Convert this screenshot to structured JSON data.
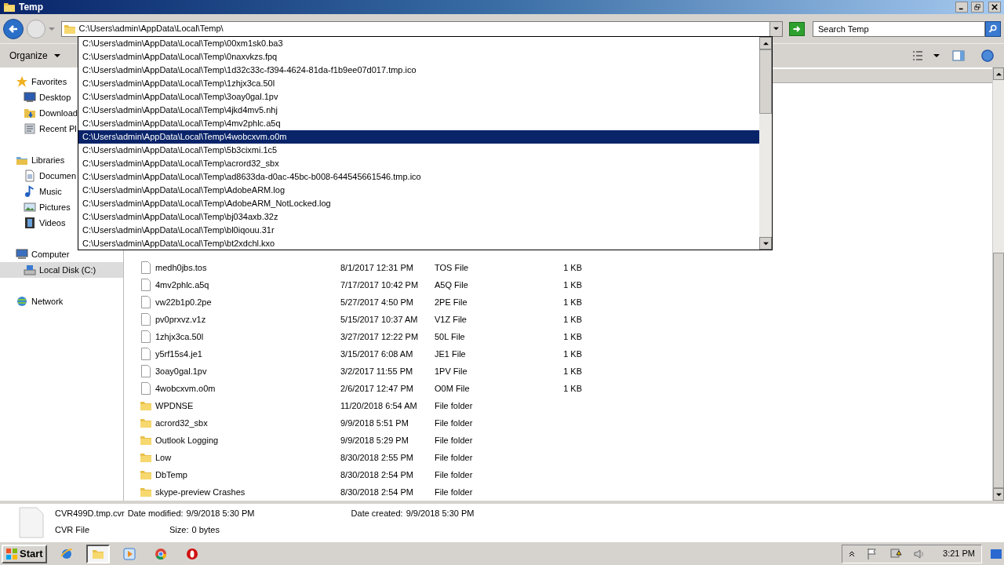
{
  "window": {
    "title": "Temp"
  },
  "address": {
    "value": "C:\\Users\\admin\\AppData\\Local\\Temp\\"
  },
  "search": {
    "placeholder": "Search Temp"
  },
  "toolbar": {
    "organize": "Organize"
  },
  "sidebar": [
    {
      "label": "Favorites",
      "kind": "star",
      "selected": false,
      "children": [
        {
          "label": "Desktop",
          "kind": "desktop",
          "selected": false
        },
        {
          "label": "Download",
          "kind": "downloads",
          "selected": false
        },
        {
          "label": "Recent Pl",
          "kind": "recent",
          "selected": false
        }
      ]
    },
    {
      "label": "Libraries",
      "kind": "library",
      "selected": false,
      "children": [
        {
          "label": "Documen",
          "kind": "documents",
          "selected": false
        },
        {
          "label": "Music",
          "kind": "music",
          "selected": false
        },
        {
          "label": "Pictures",
          "kind": "pictures",
          "selected": false
        },
        {
          "label": "Videos",
          "kind": "videos",
          "selected": false
        }
      ]
    },
    {
      "label": "Computer",
      "kind": "computer",
      "selected": false,
      "children": [
        {
          "label": "Local Disk (C:)",
          "kind": "disk",
          "selected": true
        }
      ]
    },
    {
      "label": "Network",
      "kind": "network",
      "selected": false
    }
  ],
  "autocomplete": [
    {
      "text": "C:\\Users\\admin\\AppData\\Local\\Temp\\00xm1sk0.ba3",
      "selected": false
    },
    {
      "text": "C:\\Users\\admin\\AppData\\Local\\Temp\\0naxvkzs.fpq",
      "selected": false
    },
    {
      "text": "C:\\Users\\admin\\AppData\\Local\\Temp\\1d32c33c-f394-4624-81da-f1b9ee07d017.tmp.ico",
      "selected": false
    },
    {
      "text": "C:\\Users\\admin\\AppData\\Local\\Temp\\1zhjx3ca.50l",
      "selected": false
    },
    {
      "text": "C:\\Users\\admin\\AppData\\Local\\Temp\\3oay0gal.1pv",
      "selected": false
    },
    {
      "text": "C:\\Users\\admin\\AppData\\Local\\Temp\\4jkd4mv5.nhj",
      "selected": false
    },
    {
      "text": "C:\\Users\\admin\\AppData\\Local\\Temp\\4mv2phlc.a5q",
      "selected": false
    },
    {
      "text": "C:\\Users\\admin\\AppData\\Local\\Temp\\4wobcxvm.o0m",
      "selected": true
    },
    {
      "text": "C:\\Users\\admin\\AppData\\Local\\Temp\\5b3cixmi.1c5",
      "selected": false
    },
    {
      "text": "C:\\Users\\admin\\AppData\\Local\\Temp\\acrord32_sbx",
      "selected": false
    },
    {
      "text": "C:\\Users\\admin\\AppData\\Local\\Temp\\ad8633da-d0ac-45bc-b008-644545661546.tmp.ico",
      "selected": false
    },
    {
      "text": "C:\\Users\\admin\\AppData\\Local\\Temp\\AdobeARM.log",
      "selected": false
    },
    {
      "text": "C:\\Users\\admin\\AppData\\Local\\Temp\\AdobeARM_NotLocked.log",
      "selected": false
    },
    {
      "text": "C:\\Users\\admin\\AppData\\Local\\Temp\\bj034axb.32z",
      "selected": false
    },
    {
      "text": "C:\\Users\\admin\\AppData\\Local\\Temp\\bl0iqouu.31r",
      "selected": false
    },
    {
      "text": "C:\\Users\\admin\\AppData\\Local\\Temp\\bt2xdchl.kxo",
      "selected": false
    }
  ],
  "files": [
    {
      "kind": "file",
      "name": "medh0jbs.tos",
      "date": "8/1/2017 12:31 PM",
      "type": "TOS File",
      "size": "1 KB"
    },
    {
      "kind": "file",
      "name": "4mv2phlc.a5q",
      "date": "7/17/2017 10:42 PM",
      "type": "A5Q File",
      "size": "1 KB"
    },
    {
      "kind": "file",
      "name": "vw22b1p0.2pe",
      "date": "5/27/2017 4:50 PM",
      "type": "2PE File",
      "size": "1 KB"
    },
    {
      "kind": "file",
      "name": "pv0prxvz.v1z",
      "date": "5/15/2017 10:37 AM",
      "type": "V1Z File",
      "size": "1 KB"
    },
    {
      "kind": "file",
      "name": "1zhjx3ca.50l",
      "date": "3/27/2017 12:22 PM",
      "type": "50L File",
      "size": "1 KB"
    },
    {
      "kind": "file",
      "name": "y5rf15s4.je1",
      "date": "3/15/2017 6:08 AM",
      "type": "JE1 File",
      "size": "1 KB"
    },
    {
      "kind": "file",
      "name": "3oay0gal.1pv",
      "date": "3/2/2017 11:55 PM",
      "type": "1PV File",
      "size": "1 KB"
    },
    {
      "kind": "file",
      "name": "4wobcxvm.o0m",
      "date": "2/6/2017 12:47 PM",
      "type": "O0M File",
      "size": "1 KB"
    },
    {
      "kind": "folder",
      "name": "WPDNSE",
      "date": "11/20/2018 6:54 AM",
      "type": "File folder"
    },
    {
      "kind": "folder",
      "name": "acrord32_sbx",
      "date": "9/9/2018 5:51 PM",
      "type": "File folder"
    },
    {
      "kind": "folder",
      "name": "Outlook Logging",
      "date": "9/9/2018 5:29 PM",
      "type": "File folder"
    },
    {
      "kind": "folder",
      "name": "Low",
      "date": "8/30/2018 2:55 PM",
      "type": "File folder"
    },
    {
      "kind": "folder",
      "name": "DbTemp",
      "date": "8/30/2018 2:54 PM",
      "type": "File folder"
    },
    {
      "kind": "folder",
      "name": "skype-preview Crashes",
      "date": "8/30/2018 2:54 PM",
      "type": "File folder"
    }
  ],
  "details": {
    "name": "CVR499D.tmp.cvr",
    "type": "CVR File",
    "modified_label": "Date modified:",
    "modified": "9/9/2018 5:30 PM",
    "created_label": "Date created:",
    "created": "9/9/2018 5:30 PM",
    "size_label": "Size:",
    "size": "0 bytes"
  },
  "taskbar": {
    "start": "Start",
    "apps": [
      {
        "kind": "ie",
        "active": false
      },
      {
        "kind": "explorer",
        "active": true
      },
      {
        "kind": "media",
        "active": false
      },
      {
        "kind": "chrome",
        "active": false
      },
      {
        "kind": "opera",
        "active": false
      }
    ],
    "time": "3:21 PM"
  }
}
